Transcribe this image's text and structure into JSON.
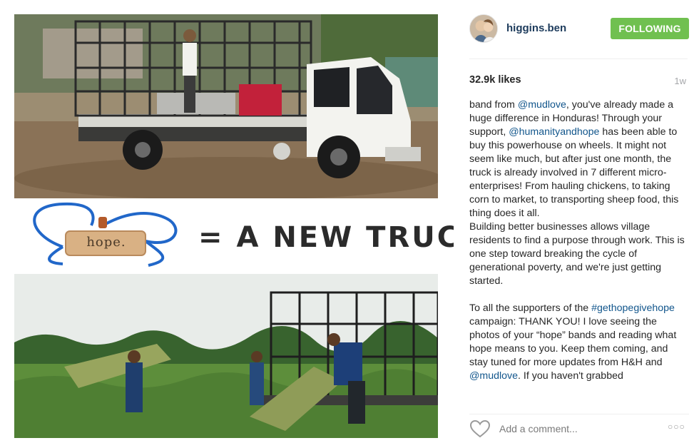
{
  "media": {
    "tag_text": "hope.",
    "headline": "= A NEW TRUCK"
  },
  "post": {
    "username": "higgins.ben",
    "follow_label": "FOLLOWING",
    "likes": "32.9k likes",
    "age": "1w",
    "caption": {
      "p1_a": "band from ",
      "p1_mention1": "@mudlove",
      "p1_b": ", you've already made a huge difference in Honduras! Through your support, ",
      "p1_mention2": "@humanityandhope",
      "p1_c": " has been able to buy this powerhouse on wheels. It might not seem like much, but after just one month, the truck is already involved in 7 different micro-enterprises! From hauling chickens, to taking corn to market, to transporting sheep food, this thing does it all.",
      "p2": "Building better businesses allows village residents to find a purpose through work. This is one step toward breaking the cycle of generational poverty, and we're just getting started.",
      "p3_a": "To all the supporters of the ",
      "p3_hashtag": "#gethopegivehope",
      "p3_b": " campaign: THANK YOU! I love seeing the photos of your “hope” bands and reading what hope means to you. Keep them coming, and stay tuned for more updates from H&H and ",
      "p3_mention": "@mudlove",
      "p3_c": ". If you haven't grabbed"
    },
    "comment_placeholder": "Add a comment...",
    "more_label": "○○○",
    "colors": {
      "follow_bg": "#70c050",
      "link": "#12568c",
      "username": "#1d3b5c"
    }
  }
}
